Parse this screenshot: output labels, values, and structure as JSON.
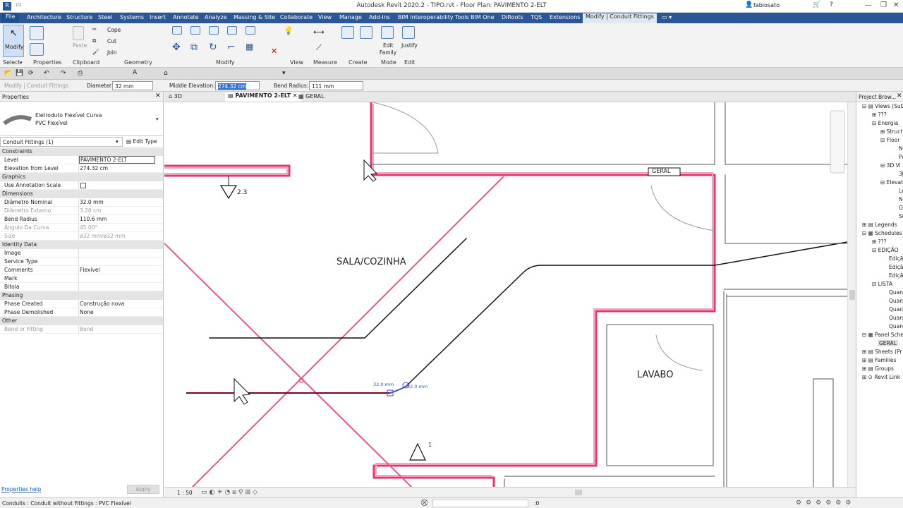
{
  "titlebar": {
    "title": "Autodesk Revit 2020.2 - TIPO.rvt - Floor Plan: PAVIMENTO 2-ELT",
    "user": "fabiosato"
  },
  "menu": {
    "file": "File",
    "items": [
      "Architecture",
      "Structure",
      "Steel",
      "Systems",
      "Insert",
      "Annotate",
      "Analyze",
      "Massing & Site",
      "Collaborate",
      "View",
      "Manage",
      "Add-Ins",
      "BIM Interoperability Tools",
      "BIM One",
      "DiRoots",
      "TQS",
      "Extensions"
    ],
    "active": "Modify | Conduit Fittings"
  },
  "ribbon": {
    "modify": "Modify",
    "select": "Select",
    "properties": "Properties",
    "clipboard": "Clipboard",
    "paste": "Paste",
    "geometry": "Geometry",
    "modify_panel": "Modify",
    "view": "View",
    "measure": "Measure",
    "create": "Create",
    "mode": "Mode",
    "edit": "Edit",
    "cope": "Cope",
    "cut": "Cut",
    "join": "Join",
    "edit_family": "Edit Family",
    "justify": "Justify"
  },
  "options": {
    "context": "Modify | Conduit Fittings",
    "diameter_label": "Diameter:",
    "diameter_value": "32 mm",
    "middle_label": "Middle Elevation:",
    "middle_value": "274.32 cm",
    "bend_label": "Bend Radius:",
    "bend_value": "111 mm"
  },
  "properties": {
    "title": "Properties",
    "type_name": "Eletroduto Flexível Curva",
    "type_sub": "PVC Flexível",
    "selector": "Conduit Fittings (1)",
    "edit_type": "Edit Type",
    "sections": {
      "constraints": "Constraints",
      "graphics": "Graphics",
      "dimensions": "Dimensions",
      "identity": "Identity Data",
      "phasing": "Phasing",
      "other": "Other"
    },
    "rows": {
      "level": [
        "Level",
        "PAVIMENTO 2-ELT"
      ],
      "elev": [
        "Elevation from Level",
        "274.32 cm"
      ],
      "anno": [
        "Use Annotation Scale",
        ""
      ],
      "diam_nom": [
        "Diâmetro Nominal",
        "32.0 mm"
      ],
      "diam_ext": [
        "Diâmetro Externo",
        "3.20 cm"
      ],
      "bend": [
        "Bend Radius",
        "110.6 mm"
      ],
      "angle": [
        "Ângulo Da Curva",
        "45.00°"
      ],
      "size": [
        "Size",
        "ø32 mm/ø32 mm"
      ],
      "image": [
        "Image",
        ""
      ],
      "service": [
        "Service Type",
        ""
      ],
      "comments": [
        "Comments",
        "Flexível"
      ],
      "mark": [
        "Mark",
        ""
      ],
      "bitola": [
        "Bitola",
        ""
      ],
      "phase_created": [
        "Phase Created",
        "Construção nova"
      ],
      "phase_demo": [
        "Phase Demolished",
        "None"
      ],
      "bend_fit": [
        "Bend or Fitting",
        "Bend"
      ]
    },
    "help": "Properties help",
    "apply": "Apply"
  },
  "tabs": [
    {
      "label": "3D"
    },
    {
      "label": "PAVIMENTO 2-ELT"
    },
    {
      "label": "GERAL"
    }
  ],
  "canvas": {
    "room1": "SALA/COZINHA",
    "room2": "LAVABO",
    "tag": "GERAL",
    "marker1": "2.3",
    "marker2": "1",
    "dim1": "32.0 mm",
    "dim2": "32.0 mm"
  },
  "viewbar": {
    "scale": "1 : 50"
  },
  "browser": {
    "title": "Project Brow...",
    "items": [
      "Views (Sub",
      "???",
      "Energia",
      "Struct",
      "Floor",
      "N",
      "P/",
      "3D Vi",
      "3[",
      "Elevat",
      "Le",
      "N",
      "O",
      "Su",
      "Legends",
      "Schedules",
      "???",
      "EDIÇÃO",
      "Ediçã",
      "Ediçã",
      "Ediçã",
      "LISTA",
      "Quan",
      "Quan",
      "Quan",
      "Quan",
      "Quan",
      "Panel Sche",
      "GERAL",
      "Sheets (Pr",
      "Families",
      "Groups",
      "Revit Link"
    ]
  },
  "status": {
    "text": "Conduits : Conduit without Fittings : PVC Flexível",
    "count": ":0"
  }
}
